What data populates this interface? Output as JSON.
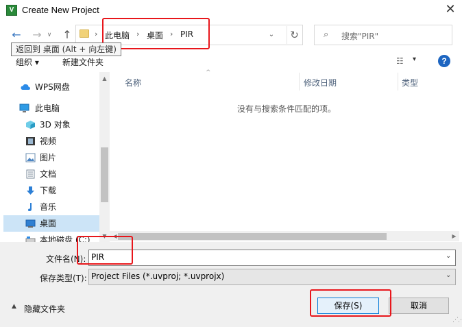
{
  "window": {
    "title": "Create New Project",
    "app_icon_letter": "V",
    "close_glyph": "✕"
  },
  "nav": {
    "back_glyph": "←",
    "forward_glyph": "→",
    "recent_glyph": "∨",
    "up_glyph": "↑",
    "crumb_sep": "›",
    "breadcrumbs": [
      "此电脑",
      "桌面",
      "PIR"
    ],
    "address_dropdown_glyph": "⌄",
    "refresh_glyph": "↻",
    "search_placeholder": "搜索\"PIR\"",
    "search_glyph": "⌕"
  },
  "tooltip": {
    "text": "返回到 桌面 (Alt + 向左键)"
  },
  "toolbar": {
    "organize_label": "组织 ▾",
    "new_folder_label": "新建文件夹",
    "view_glyph": "☷",
    "view_dropdown_glyph": "▾",
    "help_glyph": "?"
  },
  "sidebar": {
    "items": [
      {
        "label": "WPS网盘",
        "icon": "cloud-icon",
        "selected": false
      },
      {
        "label": "此电脑",
        "icon": "computer-icon",
        "selected": false
      },
      {
        "label": "3D 对象",
        "icon": "cube-icon",
        "selected": false
      },
      {
        "label": "视频",
        "icon": "video-icon",
        "selected": false
      },
      {
        "label": "图片",
        "icon": "picture-icon",
        "selected": false
      },
      {
        "label": "文档",
        "icon": "document-icon",
        "selected": false
      },
      {
        "label": "下载",
        "icon": "download-icon",
        "selected": false
      },
      {
        "label": "音乐",
        "icon": "music-icon",
        "selected": false
      },
      {
        "label": "桌面",
        "icon": "desktop-icon",
        "selected": true
      },
      {
        "label": "本地磁盘 (C:)",
        "icon": "drive-icon",
        "selected": false
      }
    ],
    "scroll_up_glyph": "▲",
    "scroll_down_glyph": "▼"
  },
  "filelist": {
    "columns": [
      "名称",
      "修改日期",
      "类型"
    ],
    "sort_glyph": "^",
    "empty_message": "没有与搜索条件匹配的项。",
    "scroll_left_glyph": "◀",
    "scroll_right_glyph": "▶"
  },
  "form": {
    "filename_label": "文件名(N):",
    "filename_value": "PIR",
    "filetype_label": "保存类型(T):",
    "filetype_value": "Project Files (*.uvproj; *.uvprojx)",
    "dropdown_glyph": "⌄"
  },
  "footer": {
    "hide_folders_label": "隐藏文件夹",
    "hide_caret_glyph": "▲",
    "save_label": "保存(S)",
    "cancel_label": "取消"
  },
  "colors": {
    "highlight_red": "#e8161b",
    "selection_blue": "#cce4f7",
    "primary_border": "#0078d7",
    "help_blue": "#1d65c1"
  }
}
